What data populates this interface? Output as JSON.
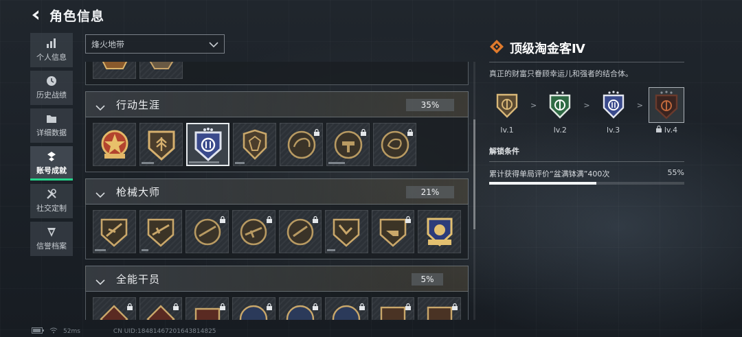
{
  "header": {
    "title": "角色信息"
  },
  "sidebar": {
    "items": [
      {
        "label": "个人信息",
        "icon": "bar-chart-icon"
      },
      {
        "label": "历史战绩",
        "icon": "clock-icon"
      },
      {
        "label": "详细数据",
        "icon": "folder-icon"
      },
      {
        "label": "账号成就",
        "icon": "achievement-icon",
        "active": true
      },
      {
        "label": "社交定制",
        "icon": "tools-icon"
      },
      {
        "label": "信誉档案",
        "icon": "reputation-icon"
      }
    ]
  },
  "filter": {
    "selected": "烽火地带"
  },
  "sections": [
    {
      "name": "行动生涯",
      "percent": "35%"
    },
    {
      "name": "枪械大师",
      "percent": "21%"
    },
    {
      "name": "全能干员",
      "percent": "5%"
    }
  ],
  "detail": {
    "title": "顶级淘金客Ⅳ",
    "description": "真正的财富只眷顾幸运儿和强者的结合体。",
    "tiers": [
      {
        "label": "lv.1"
      },
      {
        "label": "lv.2"
      },
      {
        "label": "lv.3"
      },
      {
        "label": "lv.4",
        "locked": true
      }
    ],
    "tier_separator": ">",
    "unlock_title": "解锁条件",
    "condition_text": "累计获得单局评价“盆满钵满”400次",
    "condition_percent": "55%",
    "condition_progress": 0.55
  },
  "status": {
    "ping": "52ms",
    "uid": "CN UID:18481467201643814825"
  },
  "colors": {
    "accent": "#24d48a",
    "brand_orange": "#e07a2c"
  }
}
